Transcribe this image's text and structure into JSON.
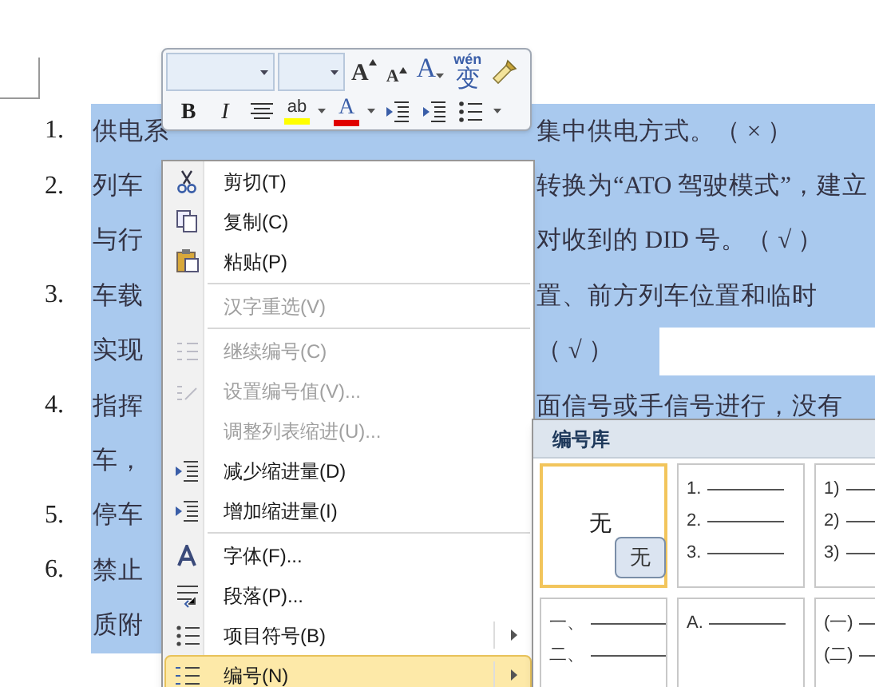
{
  "document": {
    "paragraphs": [
      {
        "number": "1.",
        "left": "供电系",
        "right": "集中供电方式。（ × ）",
        "selected": true
      },
      {
        "number": "2.",
        "left": "列车",
        "right": "转换为“ATO 驾驶模式”，建立",
        "selected": true
      },
      {
        "left": "与行",
        "right": "对收到的 DID 号。（ √ ）",
        "selected": true
      },
      {
        "number": "3.",
        "left": "车载",
        "right": "置、前方列车位置和临时",
        "selected": true
      },
      {
        "left": "实现",
        "right": "（ √ ）",
        "selected": true
      },
      {
        "number": "4.",
        "left": "指挥",
        "right": "面信号或手信号进行，没有",
        "selected": true
      },
      {
        "left": "车，",
        "selected": true
      },
      {
        "number": "5.",
        "left": "停车",
        "selected": true
      },
      {
        "number": "6.",
        "left": "禁止",
        "selected": true
      },
      {
        "left": "质附",
        "selected": true
      }
    ]
  },
  "mini_toolbar": {
    "row_1": [
      {
        "kind": "grow",
        "label": "A"
      },
      {
        "kind": "shrink",
        "label": "A"
      },
      {
        "kind": "effects",
        "label": "A"
      },
      {
        "kind": "phonetic",
        "label": "wén",
        "label_2": "变"
      },
      {
        "kind": "painter"
      }
    ],
    "row_2": [
      {
        "kind": "bold",
        "label": "B"
      },
      {
        "kind": "italic",
        "label": "I"
      },
      {
        "kind": "center"
      },
      {
        "kind": "highlight",
        "label": "ab"
      },
      {
        "kind": "dropdown"
      },
      {
        "kind": "font_color",
        "label": "A"
      },
      {
        "kind": "dropdown"
      },
      {
        "kind": "outdent"
      },
      {
        "kind": "indent"
      },
      {
        "kind": "bullets"
      },
      {
        "kind": "dropdown"
      }
    ]
  },
  "context_menu": {
    "items": [
      {
        "kind": "item",
        "label": "剪切(T)",
        "disabled": false,
        "selected": false,
        "submenu": false
      },
      {
        "kind": "item",
        "label": "复制(C)",
        "disabled": false,
        "selected": false,
        "submenu": false
      },
      {
        "kind": "item",
        "label": "粘贴(P)",
        "disabled": false,
        "selected": false,
        "submenu": false
      },
      {
        "kind": "separator"
      },
      {
        "kind": "item",
        "label": "汉字重选(V)",
        "disabled": true,
        "selected": false,
        "submenu": false
      },
      {
        "kind": "separator"
      },
      {
        "kind": "item",
        "label": "继续编号(C)",
        "disabled": true,
        "selected": false,
        "submenu": false
      },
      {
        "kind": "item",
        "label": "设置编号值(V)...",
        "disabled": true,
        "selected": false,
        "submenu": false
      },
      {
        "kind": "item",
        "label": "调整列表缩进(U)...",
        "disabled": true,
        "selected": false,
        "submenu": false
      },
      {
        "kind": "item",
        "label": "减少缩进量(D)",
        "disabled": false,
        "selected": false,
        "submenu": false
      },
      {
        "kind": "item",
        "label": "增加缩进量(I)",
        "disabled": false,
        "selected": false,
        "submenu": false
      },
      {
        "kind": "separator"
      },
      {
        "kind": "item",
        "label": "字体(F)...",
        "disabled": false,
        "selected": false,
        "submenu": false
      },
      {
        "kind": "item",
        "label": "段落(P)...",
        "disabled": false,
        "selected": false,
        "submenu": false
      },
      {
        "kind": "item",
        "label": "项目符号(B)",
        "disabled": false,
        "selected": false,
        "submenu": true
      },
      {
        "kind": "item",
        "label": "编号(N)",
        "disabled": false,
        "selected": true,
        "submenu": true
      }
    ]
  },
  "numbering_library": {
    "title": "编号库",
    "tiles": [
      {
        "kind": "none",
        "label": "无",
        "tooltip": "无",
        "selected": true
      },
      {
        "kind": "list",
        "markers": [
          "1.",
          "2.",
          "3."
        ],
        "selected": false
      },
      {
        "kind": "list",
        "markers": [
          "1)",
          "2)",
          "3)"
        ],
        "selected": false
      },
      {
        "kind": "list",
        "markers": [
          "一、",
          "二、"
        ],
        "selected": false
      },
      {
        "kind": "list",
        "markers": [
          "A."
        ],
        "selected": false
      },
      {
        "kind": "list",
        "markers": [
          "(一)",
          "(二)"
        ],
        "selected": false
      }
    ]
  }
}
